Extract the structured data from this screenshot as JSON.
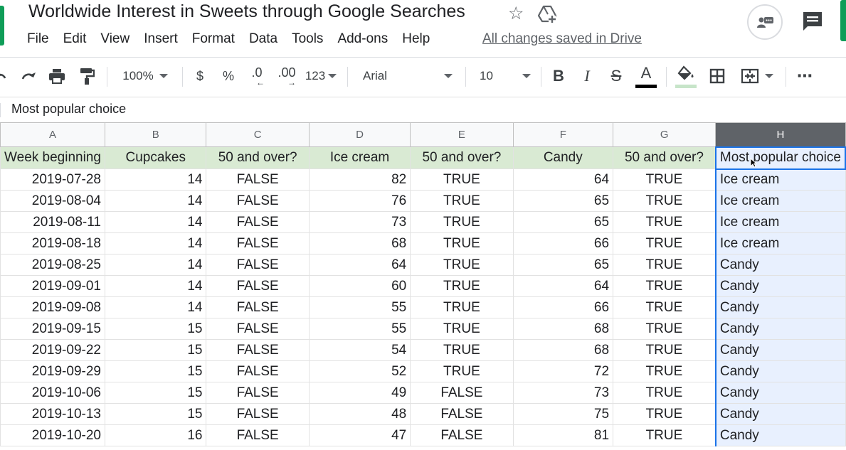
{
  "app": {
    "title": "Worldwide Interest in Sweets through Google Searches",
    "save_status": "All changes saved in Drive",
    "menu": [
      "File",
      "Edit",
      "View",
      "Insert",
      "Format",
      "Data",
      "Tools",
      "Add-ons",
      "Help"
    ]
  },
  "toolbar": {
    "zoom": "100%",
    "currency": "$",
    "percent": "%",
    "decrease_decimal": ".0",
    "increase_decimal": ".00",
    "more_formats": "123",
    "font": "Arial",
    "font_size": "10",
    "bold": "B",
    "italic": "I",
    "strikethrough": "S",
    "text_color": "A",
    "more": "⋯"
  },
  "formula_bar": {
    "content": "Most popular choice"
  },
  "colors": {
    "header_fill": "#d9ead3",
    "selection_blue": "#1a73e8",
    "selection_fill": "#e8f0fe",
    "brand_green": "#0f9d58"
  },
  "sheet": {
    "column_letters": [
      "A",
      "B",
      "C",
      "D",
      "E",
      "F",
      "G",
      "H"
    ],
    "selected_column": "H",
    "headers": [
      "Week beginning",
      "Cupcakes",
      "50 and over?",
      "Ice cream",
      "50 and over?",
      "Candy",
      "50 and over?",
      "Most popular choice"
    ],
    "rows": [
      [
        "2019-07-28",
        "14",
        "FALSE",
        "82",
        "TRUE",
        "64",
        "TRUE",
        "Ice cream"
      ],
      [
        "2019-08-04",
        "14",
        "FALSE",
        "76",
        "TRUE",
        "65",
        "TRUE",
        "Ice cream"
      ],
      [
        "2019-08-11",
        "14",
        "FALSE",
        "73",
        "TRUE",
        "65",
        "TRUE",
        "Ice cream"
      ],
      [
        "2019-08-18",
        "14",
        "FALSE",
        "68",
        "TRUE",
        "66",
        "TRUE",
        "Ice cream"
      ],
      [
        "2019-08-25",
        "14",
        "FALSE",
        "64",
        "TRUE",
        "65",
        "TRUE",
        "Candy"
      ],
      [
        "2019-09-01",
        "14",
        "FALSE",
        "60",
        "TRUE",
        "64",
        "TRUE",
        "Candy"
      ],
      [
        "2019-09-08",
        "14",
        "FALSE",
        "55",
        "TRUE",
        "66",
        "TRUE",
        "Candy"
      ],
      [
        "2019-09-15",
        "15",
        "FALSE",
        "55",
        "TRUE",
        "68",
        "TRUE",
        "Candy"
      ],
      [
        "2019-09-22",
        "15",
        "FALSE",
        "54",
        "TRUE",
        "68",
        "TRUE",
        "Candy"
      ],
      [
        "2019-09-29",
        "15",
        "FALSE",
        "52",
        "TRUE",
        "72",
        "TRUE",
        "Candy"
      ],
      [
        "2019-10-06",
        "15",
        "FALSE",
        "49",
        "FALSE",
        "73",
        "TRUE",
        "Candy"
      ],
      [
        "2019-10-13",
        "15",
        "FALSE",
        "48",
        "FALSE",
        "75",
        "TRUE",
        "Candy"
      ],
      [
        "2019-10-20",
        "16",
        "FALSE",
        "47",
        "FALSE",
        "81",
        "TRUE",
        "Candy"
      ]
    ]
  }
}
